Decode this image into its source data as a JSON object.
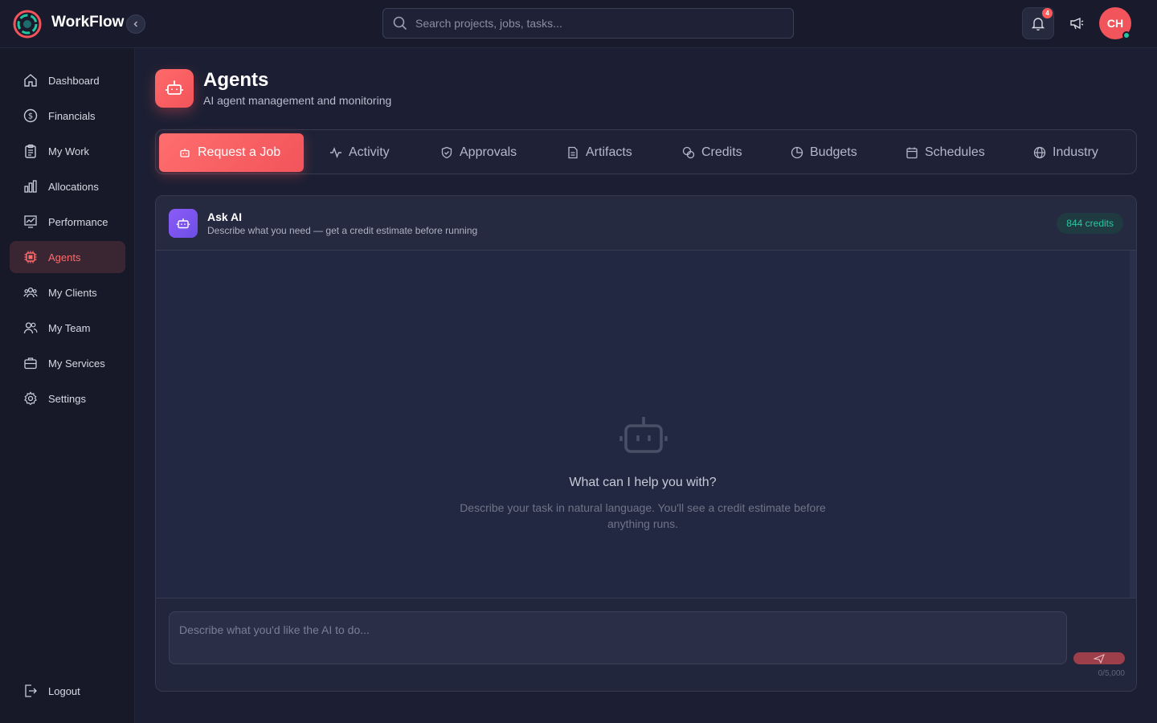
{
  "app": {
    "brand": "WorkFlow"
  },
  "header": {
    "search_placeholder": "Search projects, jobs, tasks...",
    "notification_count": "4",
    "avatar_initials": "CH"
  },
  "sidebar": {
    "items": [
      {
        "label": "Dashboard",
        "icon": "home-icon",
        "active": false
      },
      {
        "label": "Financials",
        "icon": "dollar-icon",
        "active": false
      },
      {
        "label": "My Work",
        "icon": "clipboard-icon",
        "active": false
      },
      {
        "label": "Allocations",
        "icon": "bar-chart-icon",
        "active": false
      },
      {
        "label": "Performance",
        "icon": "trend-chart-icon",
        "active": false
      },
      {
        "label": "Agents",
        "icon": "chip-icon",
        "active": true
      },
      {
        "label": "My Clients",
        "icon": "users-group-icon",
        "active": false
      },
      {
        "label": "My Team",
        "icon": "users-icon",
        "active": false
      },
      {
        "label": "My Services",
        "icon": "briefcase-icon",
        "active": false
      },
      {
        "label": "Settings",
        "icon": "gear-icon",
        "active": false
      }
    ],
    "logout_label": "Logout"
  },
  "page": {
    "title": "Agents",
    "subtitle": "AI agent management and monitoring"
  },
  "tabs": [
    {
      "label": "Request a Job",
      "icon": "robot-icon",
      "active": true
    },
    {
      "label": "Activity",
      "icon": "activity-icon",
      "active": false
    },
    {
      "label": "Approvals",
      "icon": "shield-check-icon",
      "active": false
    },
    {
      "label": "Artifacts",
      "icon": "document-icon",
      "active": false
    },
    {
      "label": "Credits",
      "icon": "coins-icon",
      "active": false
    },
    {
      "label": "Budgets",
      "icon": "pie-chart-icon",
      "active": false
    },
    {
      "label": "Schedules",
      "icon": "calendar-icon",
      "active": false
    },
    {
      "label": "Industry",
      "icon": "globe-icon",
      "active": false
    }
  ],
  "ask_ai": {
    "title": "Ask AI",
    "description": "Describe what you need — get a credit estimate before running",
    "credits": "844 credits",
    "empty_title": "What can I help you with?",
    "empty_description": "Describe your task in natural language. You'll see a credit estimate before anything runs.",
    "input_placeholder": "Describe what you'd like the AI to do...",
    "char_count": "0/5,000"
  },
  "colors": {
    "accent": "#f2545b",
    "credits": "#2cc6a3",
    "ai_purple": "#8b5cf6"
  }
}
